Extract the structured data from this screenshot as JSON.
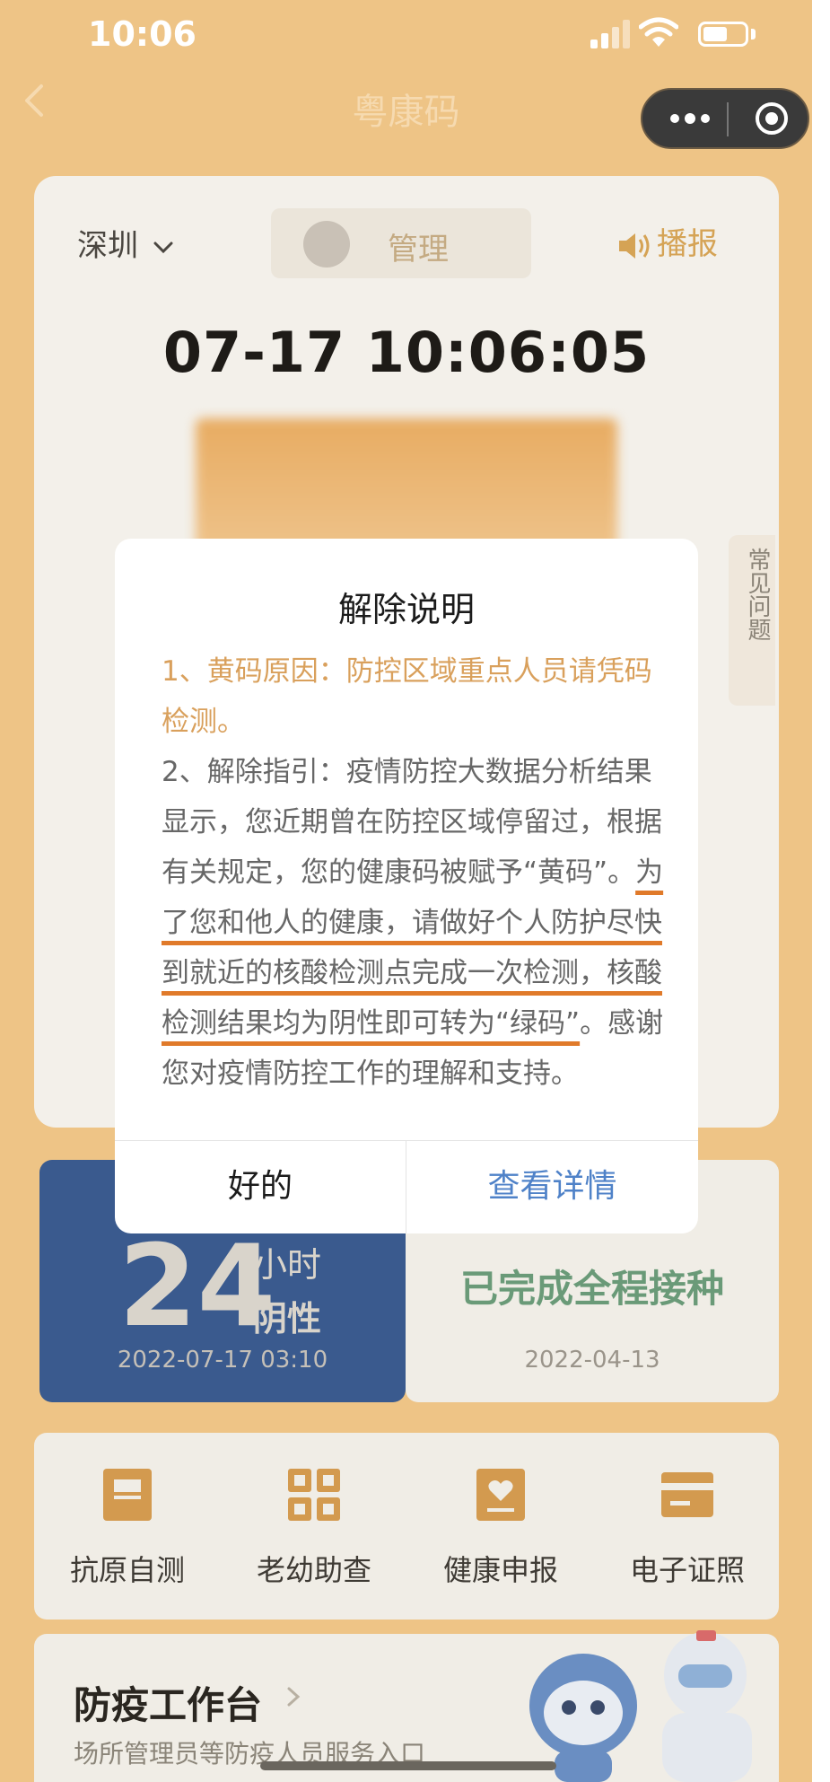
{
  "status_bar": {
    "time": "10:06"
  },
  "nav": {
    "title": "粤康码"
  },
  "card": {
    "city": "深圳",
    "manage_label": "管理",
    "broadcast_label": "播报",
    "datetime": "07-17 10:06:05"
  },
  "faq": {
    "label": "常见问题"
  },
  "test": {
    "number": "24",
    "unit": "小时",
    "result": "阴性",
    "time": "2022-07-17 03:10"
  },
  "vaccine": {
    "status": "已完成全程接种",
    "date": "2022-04-13"
  },
  "services": [
    {
      "label": "抗原自测",
      "icon": "antigen-box-icon"
    },
    {
      "label": "老幼助查",
      "icon": "grid-apps-icon"
    },
    {
      "label": "健康申报",
      "icon": "heart-report-icon"
    },
    {
      "label": "电子证照",
      "icon": "card-license-icon"
    }
  ],
  "workbench": {
    "title": "防疫工作台",
    "subtitle": "场所管理员等防疫人员服务入口"
  },
  "dialog": {
    "title": "解除说明",
    "reason": "1、黄码原因：防控区域重点人员请凭码检测。",
    "guide_prefix": "2、解除指引：疫情防控大数据分析结果显示，您近期曾在防控区域停留过，根据有关规定，您的健康码被赋予“黄码”。",
    "guide_emphasis": "为了您和他人的健康，请做好个人防护尽快到就近的核酸检测点完成一次检测，核酸检测结果均为阴性即可转为“绿码”",
    "guide_suffix": "。感谢您对疫情防控工作的理解和支持。",
    "ok_label": "好的",
    "detail_label": "查看详情"
  },
  "colors": {
    "overlay_orange": "#eec486",
    "reason_text": "#d9a05c",
    "underline": "#e07a2a",
    "link_blue": "#4f82c8",
    "test_blue": "#3a5a8e",
    "vaccine_green": "#6a9a78"
  }
}
